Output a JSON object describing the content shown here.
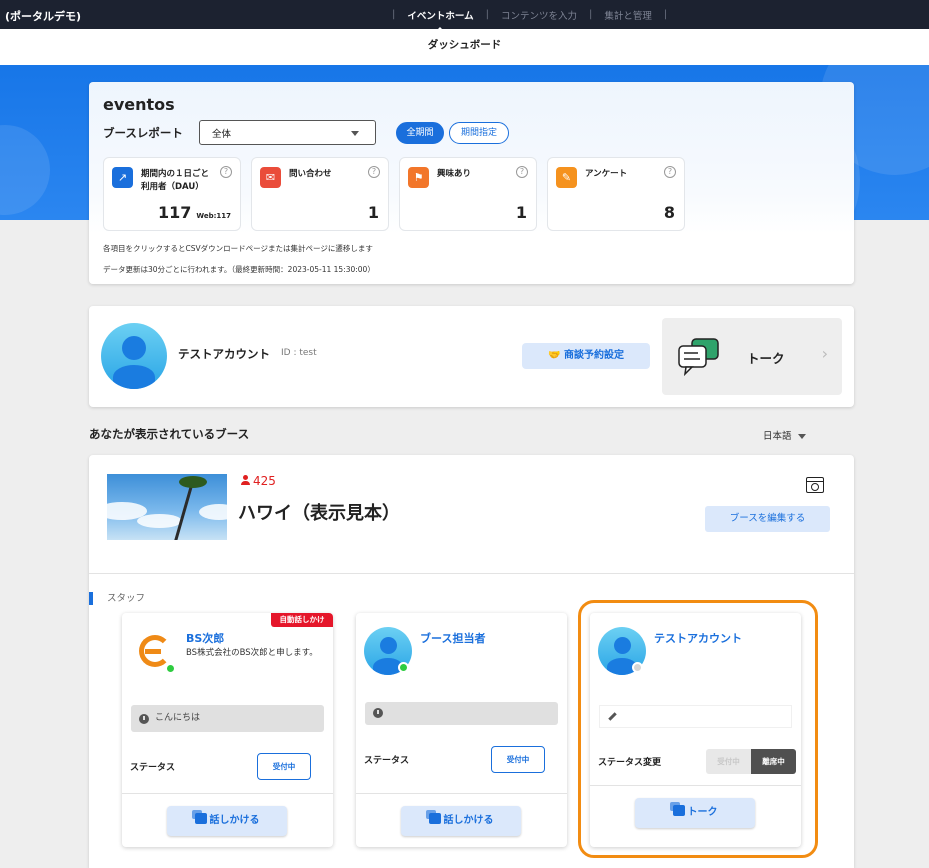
{
  "topbar": {
    "app_title": "(ポータルデモ)",
    "nav": [
      "イベントホーム",
      "コンテンツを入力",
      "集計と管理"
    ]
  },
  "subheader": {
    "title": "ダッシュボード"
  },
  "report": {
    "brand": "eventos",
    "label": "ブースレポート",
    "filter_value": "全体",
    "period_all": "全期間",
    "period_range": "期間指定",
    "stats": [
      {
        "name_line1": "期間内の１日ごと",
        "name_line2": "利用者（DAU）",
        "value": "117",
        "sub": "Web:117",
        "color": "#1a6fdc",
        "icon": "chart-icon"
      },
      {
        "name_line1": "問い合わせ",
        "name_line2": "",
        "value": "1",
        "sub": "",
        "color": "#ea4c3a",
        "icon": "inquiry-icon"
      },
      {
        "name_line1": "興味あり",
        "name_line2": "",
        "value": "1",
        "sub": "",
        "color": "#f2762a",
        "icon": "interest-icon"
      },
      {
        "name_line1": "アンケート",
        "name_line2": "",
        "value": "8",
        "sub": "",
        "color": "#f5921e",
        "icon": "survey-icon"
      }
    ],
    "note1": "各項目をクリックするとCSVダウンロードページまたは集計ページに遷移します",
    "note2": "データ更新は30分ごとに行われます。（最終更新時間：2023-05-11 15:30:00）"
  },
  "account": {
    "name": "テストアカウント",
    "id_text": "ID : test",
    "meeting_button": "商談予約設定",
    "talk_label": "トーク"
  },
  "booth_section": {
    "title": "あなたが表示されているブース",
    "language": "日本語"
  },
  "booth": {
    "visitors": "425",
    "name": "ハワイ（表示見本）",
    "edit_button": "ブースを編集する",
    "staff_label": "スタッフ"
  },
  "staff": [
    {
      "name": "BS次郎",
      "desc": "BS株式会社のBS次郎と申します。",
      "badge": "自動話しかけ",
      "message": "こんにちは",
      "status_label": "ステータス",
      "status_value": "受付中",
      "action": "話しかける",
      "online": true
    },
    {
      "name": "ブース担当者",
      "desc": "",
      "badge": "",
      "message": "",
      "status_label": "ステータス",
      "status_value": "受付中",
      "action": "話しかける",
      "online": true
    },
    {
      "name": "テストアカウント",
      "desc": "",
      "badge": "",
      "message": "",
      "status_label": "ステータス変更",
      "toggle_off": "受付中",
      "toggle_on": "離席中",
      "action": "トーク",
      "online": false
    }
  ]
}
